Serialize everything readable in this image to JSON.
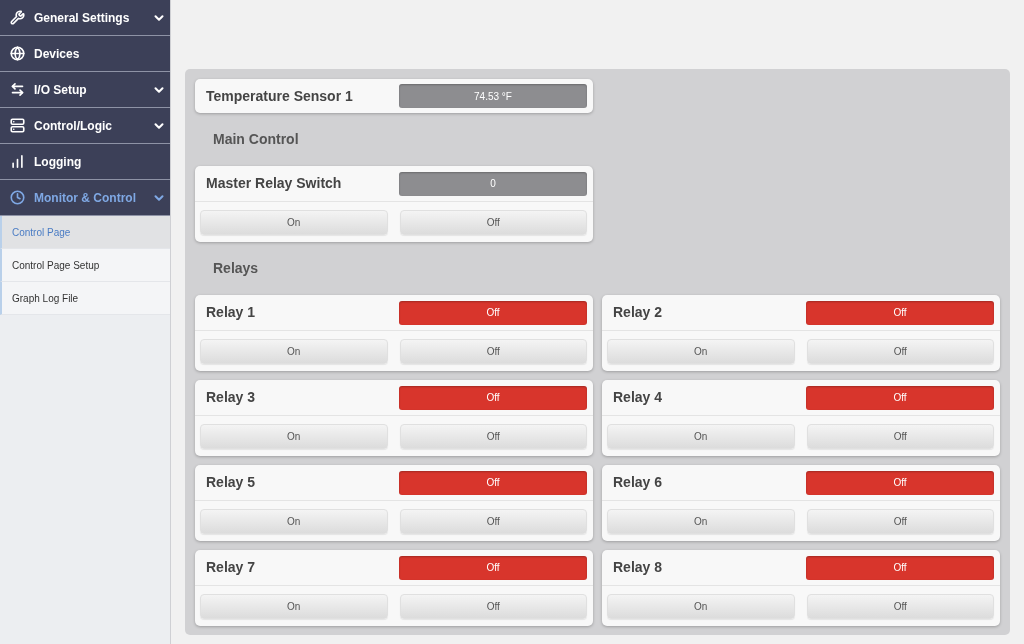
{
  "sidebar": {
    "items": [
      {
        "label": "General Settings",
        "expandable": true,
        "expanded": false
      },
      {
        "label": "Devices",
        "expandable": false,
        "expanded": false
      },
      {
        "label": "I/O Setup",
        "expandable": true,
        "expanded": false
      },
      {
        "label": "Control/Logic",
        "expandable": true,
        "expanded": false
      },
      {
        "label": "Logging",
        "expandable": false,
        "expanded": false
      },
      {
        "label": "Monitor & Control",
        "expandable": true,
        "expanded": true,
        "children": [
          {
            "label": "Control Page",
            "selected": true
          },
          {
            "label": "Control Page Setup",
            "selected": false
          },
          {
            "label": "Graph Log File",
            "selected": false
          }
        ]
      }
    ]
  },
  "panel": {
    "sensors": [
      {
        "label": "Temperature Sensor 1",
        "value": "74.53 °F"
      }
    ],
    "sections": [
      {
        "heading": "Main Control",
        "switches": [
          {
            "label": "Master Relay Switch",
            "kind": "value",
            "value": "0",
            "buttons": [
              "On",
              "Off"
            ]
          }
        ]
      },
      {
        "heading": "Relays",
        "switches": [
          {
            "label": "Relay 1",
            "kind": "relay",
            "on": false,
            "value": "Off",
            "buttons": [
              "On",
              "Off"
            ]
          },
          {
            "label": "Relay 2",
            "kind": "relay",
            "on": false,
            "value": "Off",
            "buttons": [
              "On",
              "Off"
            ]
          },
          {
            "label": "Relay 3",
            "kind": "relay",
            "on": false,
            "value": "Off",
            "buttons": [
              "On",
              "Off"
            ]
          },
          {
            "label": "Relay 4",
            "kind": "relay",
            "on": false,
            "value": "Off",
            "buttons": [
              "On",
              "Off"
            ]
          },
          {
            "label": "Relay 5",
            "kind": "relay",
            "on": false,
            "value": "Off",
            "buttons": [
              "On",
              "Off"
            ]
          },
          {
            "label": "Relay 6",
            "kind": "relay",
            "on": false,
            "value": "Off",
            "buttons": [
              "On",
              "Off"
            ]
          },
          {
            "label": "Relay 7",
            "kind": "relay",
            "on": false,
            "value": "Off",
            "buttons": [
              "On",
              "Off"
            ]
          },
          {
            "label": "Relay 8",
            "kind": "relay",
            "on": false,
            "value": "Off",
            "buttons": [
              "On",
              "Off"
            ]
          }
        ]
      }
    ]
  }
}
